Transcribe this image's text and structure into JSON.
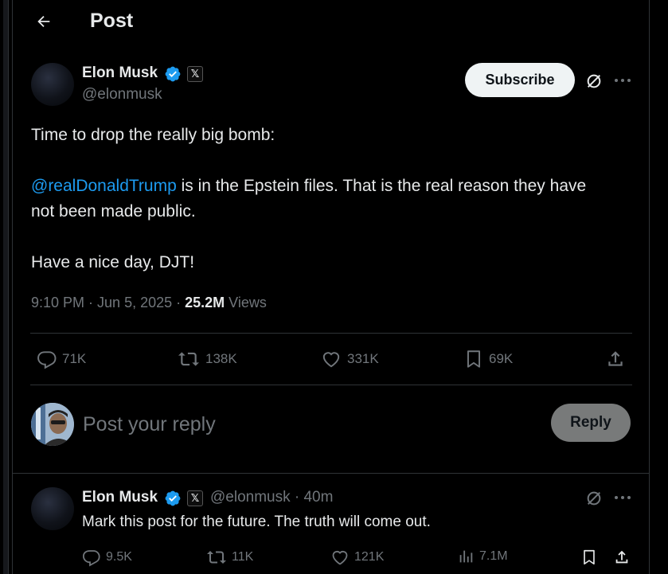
{
  "header": {
    "title": "Post"
  },
  "post": {
    "author_name": "Elon Musk",
    "x_badge": "𝕏",
    "handle": "@elonmusk",
    "subscribe_label": "Subscribe",
    "text_line1": "Time to drop the really big bomb:",
    "mention": "@realDonaldTrump",
    "text_line2_rest": " is in the Epstein files. That is the real reason they have",
    "text_line3": "not been made public.",
    "text_line4": "Have a nice day, DJT!",
    "time": "9:10 PM",
    "date": "Jun 5, 2025",
    "views_count": "25.2M",
    "views_label": "Views",
    "replies": "71K",
    "reposts": "138K",
    "likes": "331K",
    "bookmarks": "69K"
  },
  "composer": {
    "placeholder": "Post your reply",
    "reply_label": "Reply"
  },
  "reply": {
    "author_name": "Elon Musk",
    "x_badge": "𝕏",
    "handle_time": "@elonmusk · 40m",
    "text": "Mark this post for the future. The truth will come out.",
    "replies": "9.5K",
    "reposts": "11K",
    "likes": "121K",
    "views": "7.1M"
  },
  "colors": {
    "accent": "#1d9bf0",
    "muted": "#71767b",
    "text": "#e7e9ea",
    "divider": "#2f3336"
  },
  "icons": [
    "back-arrow-icon",
    "verified-badge-icon",
    "x-logo-icon",
    "grok-icon",
    "more-icon",
    "reply-icon",
    "repost-icon",
    "like-icon",
    "bookmark-icon",
    "share-icon",
    "views-icon"
  ]
}
